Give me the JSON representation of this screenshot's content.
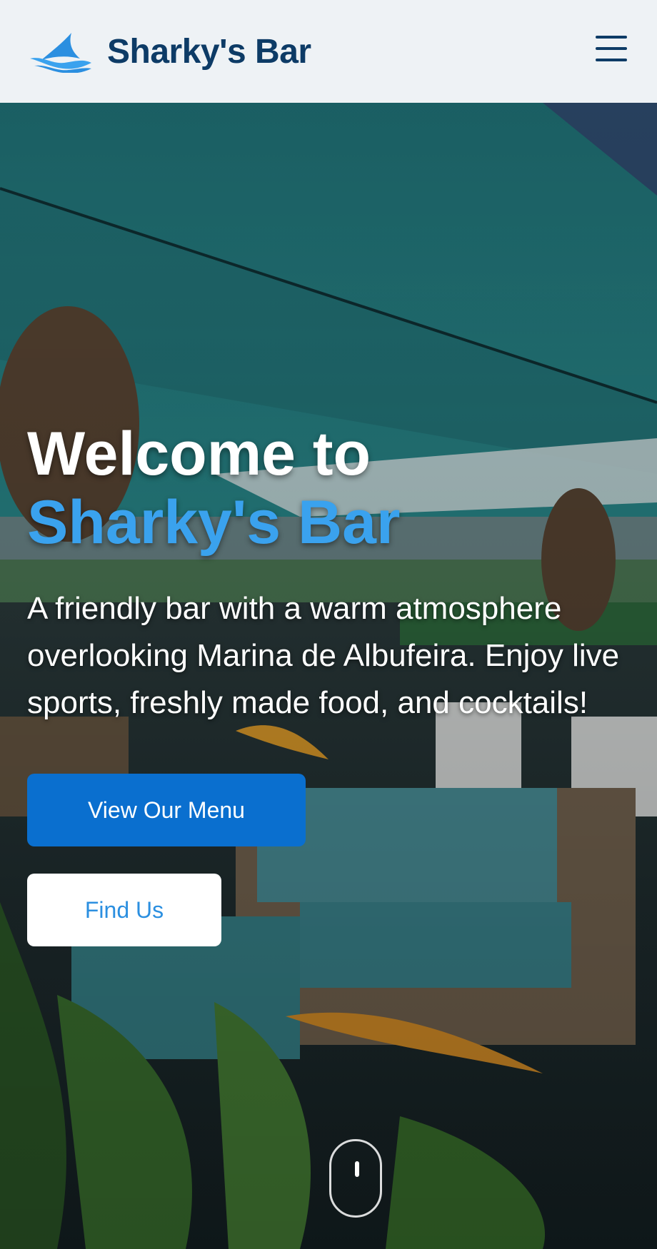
{
  "header": {
    "brand": "Sharky's Bar",
    "logo_icon": "shark-fin-wave-icon",
    "menu_icon": "hamburger-menu-icon"
  },
  "hero": {
    "title_line1": "Welcome to",
    "title_line2": "Sharky's Bar",
    "description": "A friendly bar with a warm atmosphere overlooking Marina de Albufeira. Enjoy live sports, freshly made food, and cocktails!",
    "primary_button": "View Our Menu",
    "secondary_button": "Find Us",
    "scroll_icon": "mouse-scroll-icon"
  },
  "colors": {
    "header_bg": "#eef2f5",
    "brand_text": "#0d3b66",
    "accent": "#3aa2ee",
    "primary_button": "#0a6fcf",
    "secondary_button_text": "#2b8fe0"
  }
}
